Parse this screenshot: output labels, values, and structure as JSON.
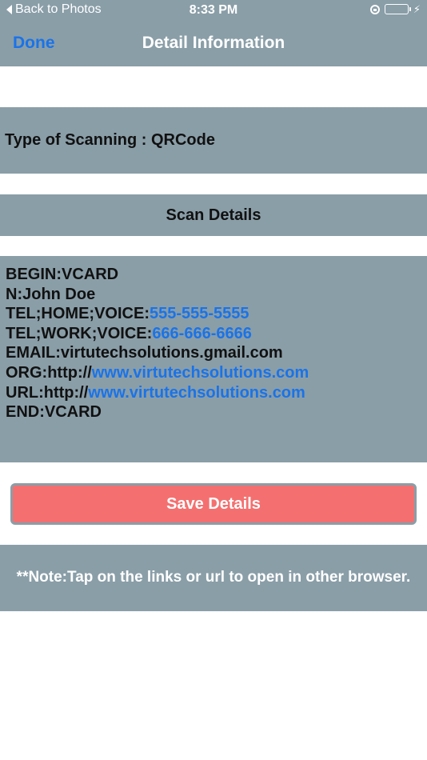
{
  "status_bar": {
    "back_label": "Back to Photos",
    "time": "8:33 PM",
    "battery_color": "#4cd964",
    "icons": [
      "back-arrow-icon",
      "rotation-lock-icon",
      "battery-icon",
      "charging-bolt-icon"
    ]
  },
  "nav": {
    "done_label": "Done",
    "title": "Detail Information"
  },
  "scan": {
    "type_label": "Type of Scanning : QRCode"
  },
  "details": {
    "header": "Scan Details",
    "lines": {
      "begin": "BEGIN:VCARD",
      "name": "N:John Doe",
      "tel_home_prefix": "TEL;HOME;VOICE:",
      "tel_home_value": "555-555-5555",
      "tel_work_prefix": "TEL;WORK;VOICE:",
      "tel_work_value": "666-666-6666",
      "email": "EMAIL:virtutechsolutions.gmail.com",
      "org_prefix": "ORG:http://",
      "org_value": "www.virtutechsolutions.com",
      "url_prefix": "URL:http://",
      "url_value": "www.virtutechsolutions.com",
      "end": "END:VCARD"
    }
  },
  "actions": {
    "save_label": "Save Details"
  },
  "note": {
    "text": "**Note:Tap on the links or url to open in other browser."
  },
  "colors": {
    "bar_background": "#8a9ea8",
    "link": "#1a73e8",
    "save_button": "#f47070"
  }
}
